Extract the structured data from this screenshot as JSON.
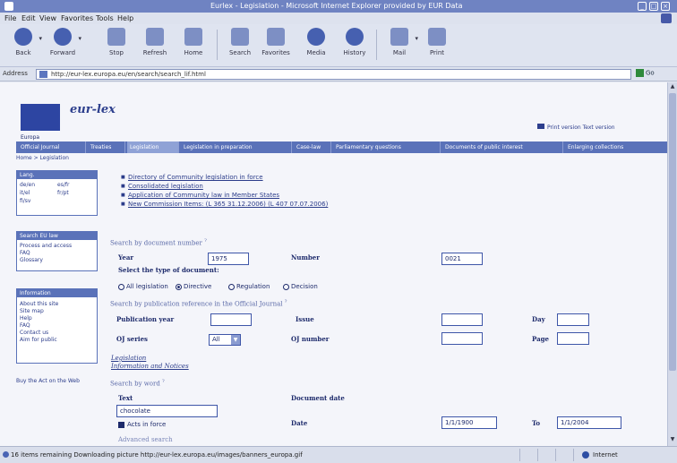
{
  "browser": {
    "title": "Eurlex - Legislation - Microsoft Internet Explorer provided by EUR Data",
    "menu": [
      "File",
      "Edit",
      "View",
      "Favorites",
      "Tools",
      "Help"
    ],
    "toolbar": {
      "back": "Back",
      "forward": "Forward",
      "stop": "Stop",
      "refresh": "Refresh",
      "home": "Home",
      "search": "Search",
      "favorites": "Favorites",
      "media": "Media",
      "history": "History",
      "mail": "Mail",
      "print": "Print"
    },
    "address_label": "Address",
    "address_value": "http://eur-lex.europa.eu/en/search/search_lif.html",
    "go_label": "Go",
    "status_text": "16 items remaining Downloading picture http://eur-lex.europa.eu/images/banners_europa.gif",
    "zone_label": "Internet"
  },
  "page": {
    "europa_label": "Europa",
    "logo_text": "eur-lex",
    "top_links": "Print version   Text version",
    "nav_tabs": [
      "Official Journal",
      "Treaties",
      "Legislation",
      "Legislation in preparation",
      "Case-law",
      "Parliamentary questions",
      "Documents of public interest",
      "Enlarging collections"
    ],
    "breadcrumb": "Home > Legislation",
    "languages_title": "Lang.",
    "languages": [
      [
        "de/en",
        "es/fr"
      ],
      [
        "it/el",
        "fr/pt"
      ],
      [
        "fi/sv",
        ""
      ]
    ],
    "search_box_title": "Search EU law",
    "search_box_items": [
      "Process and access",
      "FAQ",
      "Glossary"
    ],
    "info_box_title": "Information",
    "info_box_items": [
      "About this site",
      "Site map",
      "Help",
      "FAQ",
      "Contact us",
      "Aim for public"
    ],
    "buy_link": "Buy the Act on the Web",
    "bullets": [
      "Directory of Community legislation in force",
      "Consolidated legislation",
      "Application of Community law in Member States",
      "New Commission Items: (L 365 31.12.2006) (L 407 07.07.2006)"
    ],
    "sec_doc_number": "Search by document number",
    "year_label": "Year",
    "year_value": "1975",
    "number_label": "Number",
    "number_value": "0021",
    "doc_type_label": "Select the type of document:",
    "doc_types": [
      "All legislation",
      "Directive",
      "Regulation",
      "Decision"
    ],
    "doc_type_selected": "Directive",
    "sec_oj": "Search by publication reference in the Official Journal",
    "pub_year_label": "Publication year",
    "series_label": "Issue",
    "day_label": "Day",
    "oj_series_label": "OJ series",
    "oj_series_value": "All",
    "oj_number_label": "OJ number",
    "page_label": "Page",
    "link_legislation": "Legislation",
    "link_information": "Information and Notices",
    "sec_word": "Search by word",
    "text_label": "Text",
    "doc_date_label": "Document date",
    "text_value": "chocolate",
    "date_label": "Date",
    "date_from": "1/1/1900",
    "to_label": "To",
    "date_to": "1/1/2004",
    "acts_in_force_label": "Acts in force",
    "advanced_label": "Advanced search"
  }
}
